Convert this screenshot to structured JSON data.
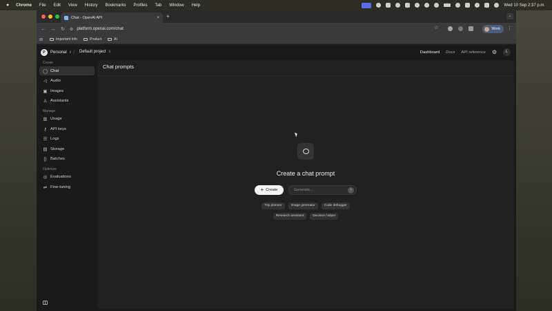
{
  "menubar": {
    "apple": "",
    "items": [
      "Chrome",
      "File",
      "Edit",
      "View",
      "History",
      "Bookmarks",
      "Profiles",
      "Tab",
      "Window",
      "Help"
    ],
    "clock": "Wed 10 Sep  2:37 p.m."
  },
  "browser": {
    "tab_title": "Chat - OpenAI API",
    "tab_close": "×",
    "new_tab": "+",
    "url": "platform.openai.com/chat",
    "profile_label": "Work",
    "bookmarks": [
      "Important Info",
      "Product",
      "AI"
    ]
  },
  "topnav": {
    "org_initial": "P",
    "org_name": "Personal",
    "project": "Default project",
    "links": [
      "Dashboard",
      "Docs",
      "API reference"
    ],
    "user_initial": "L"
  },
  "sidebar": {
    "sections": [
      {
        "label": "Create",
        "items": [
          {
            "label": "Chat",
            "icon": "chat-icon",
            "glyph": "◯"
          },
          {
            "label": "Audio",
            "icon": "audio-icon",
            "glyph": "◁"
          },
          {
            "label": "Images",
            "icon": "image-icon",
            "glyph": "▣"
          },
          {
            "label": "Assistants",
            "icon": "assistant-icon",
            "glyph": "♙"
          }
        ]
      },
      {
        "label": "Manage",
        "items": [
          {
            "label": "Usage",
            "icon": "usage-icon",
            "glyph": "▥"
          },
          {
            "label": "API keys",
            "icon": "key-icon",
            "glyph": "⚷"
          },
          {
            "label": "Logs",
            "icon": "logs-icon",
            "glyph": "☰"
          },
          {
            "label": "Storage",
            "icon": "storage-icon",
            "glyph": "▤"
          },
          {
            "label": "Batches",
            "icon": "batches-icon",
            "glyph": "{}"
          }
        ]
      },
      {
        "label": "Optimize",
        "items": [
          {
            "label": "Evaluations",
            "icon": "evaluations-icon",
            "glyph": "◎"
          },
          {
            "label": "Fine-tuning",
            "icon": "fine-tuning-icon",
            "glyph": "⇌"
          }
        ]
      }
    ]
  },
  "main": {
    "title": "Chat prompts",
    "empty_title": "Create a chat prompt",
    "create_label": "Create",
    "generate_placeholder": "Generate...",
    "chips_row1": [
      "Trip planner",
      "Image generator",
      "Code debugger"
    ],
    "chips_row2": [
      "Research assistant",
      "Decision helper"
    ]
  }
}
